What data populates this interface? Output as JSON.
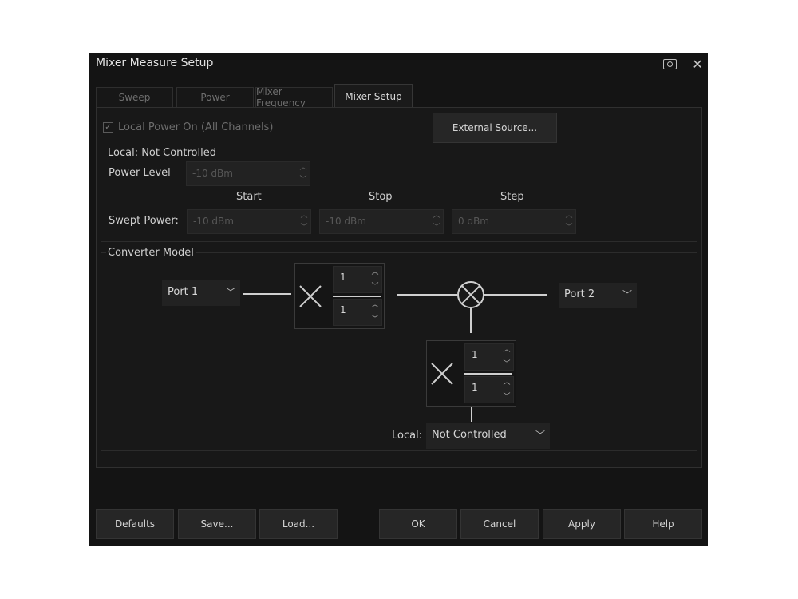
{
  "window": {
    "title": "Mixer Measure Setup",
    "icons": [
      "camera-icon",
      "close-icon"
    ]
  },
  "tabs": [
    {
      "label": "Sweep",
      "active": false
    },
    {
      "label": "Power",
      "active": false
    },
    {
      "label": "Mixer Frequency",
      "active": false
    },
    {
      "label": "Mixer Setup",
      "active": true
    }
  ],
  "local_power": {
    "label": "Local Power On (All Channels)",
    "checked": true
  },
  "external_source_button": "External Source...",
  "local_group": {
    "title": "Local: Not Controlled",
    "power_level_label": "Power Level",
    "power_level_value": "-10 dBm",
    "col_start": "Start",
    "col_stop": "Stop",
    "col_step": "Step",
    "swept_power_label": "Swept Power:",
    "start_value": "-10 dBm",
    "stop_value": "-10 dBm",
    "step_value": "0 dBm"
  },
  "converter_group": {
    "title": "Converter Model",
    "input_port": "Port 1",
    "output_port": "Port 2",
    "input_mult_num": "1",
    "input_mult_den": "1",
    "local_mult_num": "1",
    "local_mult_den": "1",
    "local_label": "Local:",
    "local_value": "Not Controlled"
  },
  "buttons": {
    "defaults": "Defaults",
    "save": "Save...",
    "load": "Load...",
    "ok": "OK",
    "cancel": "Cancel",
    "apply": "Apply",
    "help": "Help"
  }
}
